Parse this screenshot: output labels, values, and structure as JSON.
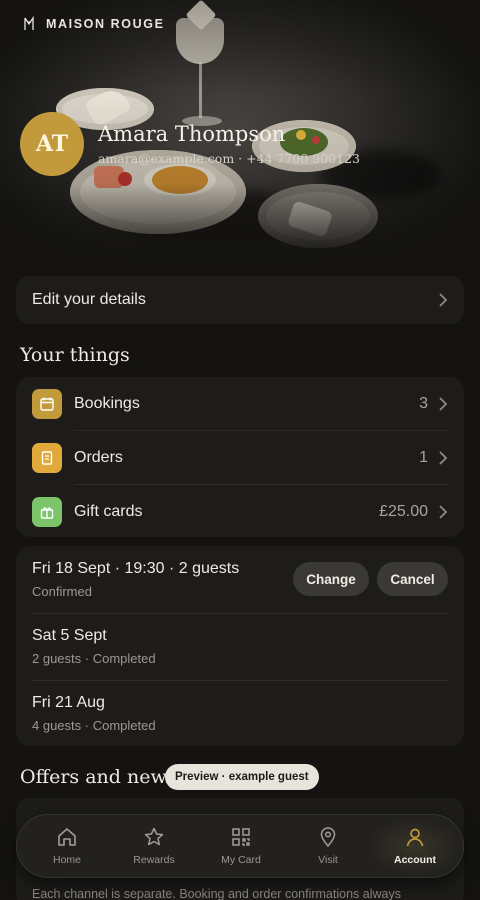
{
  "brand": {
    "name": "MAISON ROUGE",
    "icon": "maison-rouge-logo-icon"
  },
  "profile": {
    "initials": "AT",
    "name": "Amara Thompson",
    "contact": "amara@example.com · +44 7700 900123",
    "avatar_color": "#c39a3b"
  },
  "edit_details": {
    "label": "Edit your details"
  },
  "your_things": {
    "title": "Your things",
    "items": [
      {
        "label": "Bookings",
        "value": "3",
        "icon": "calendar-icon",
        "icon_color": "#c39a3b"
      },
      {
        "label": "Orders",
        "value": "1",
        "icon": "receipt-icon",
        "icon_color": "#e0a93a"
      },
      {
        "label": "Gift cards",
        "value": "£25.00",
        "icon": "gift-icon",
        "icon_color": "#7cc46a"
      }
    ]
  },
  "bookings": [
    {
      "title": "Fri 18 Sept · 19:30 · 2 guests",
      "status": "Confirmed",
      "change_label": "Change",
      "cancel_label": "Cancel"
    },
    {
      "title": "Sat 5 Sept",
      "status": "2 guests · Completed"
    },
    {
      "title": "Fri 21 Aug",
      "status": "4 guests · Completed"
    }
  ],
  "offers": {
    "title": "Offers and news",
    "preview_badge": "Preview · example guest",
    "footnote": "Each channel is separate. Booking and order confirmations always"
  },
  "nav": {
    "items": [
      {
        "label": "Home",
        "icon": "home-icon"
      },
      {
        "label": "Rewards",
        "icon": "star-icon"
      },
      {
        "label": "My Card",
        "icon": "qr-code-icon"
      },
      {
        "label": "Visit",
        "icon": "map-pin-icon"
      },
      {
        "label": "Account",
        "icon": "person-icon",
        "active": true
      }
    ],
    "active_color": "#c39a3b"
  },
  "colors": {
    "background": "#141311",
    "card": "#1d1c1a",
    "accent": "#c39a3b"
  }
}
